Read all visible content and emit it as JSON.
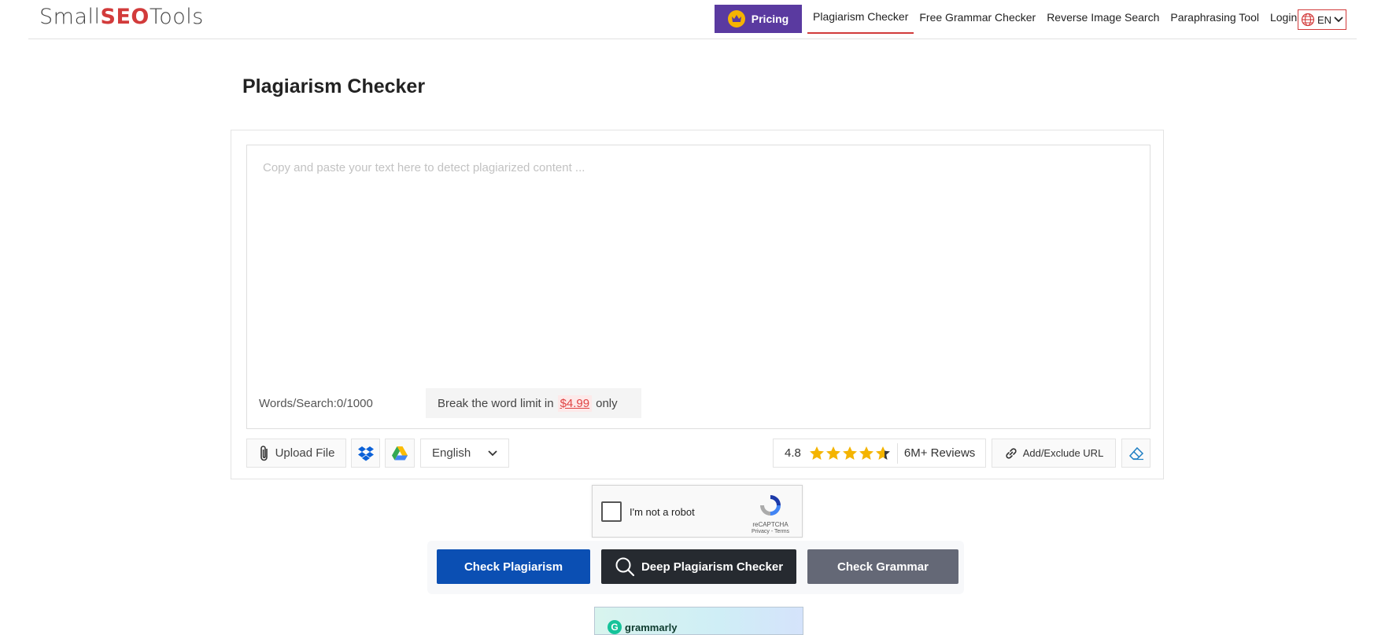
{
  "header": {
    "logo_part1": "Small",
    "logo_part2": "SEO",
    "logo_part3": "Tools",
    "pricing_label": "Pricing",
    "nav": [
      {
        "label": "Plagiarism Checker",
        "active": true
      },
      {
        "label": "Free Grammar Checker",
        "active": false
      },
      {
        "label": "Reverse Image Search",
        "active": false
      },
      {
        "label": "Paraphrasing Tool",
        "active": false
      },
      {
        "label": "Login",
        "active": false
      }
    ],
    "language": "EN"
  },
  "page_title": "Plagiarism Checker",
  "editor": {
    "placeholder": "Copy and paste your text here to detect plagiarized content ...",
    "word_count": "Words/Search:0/1000",
    "limit_prefix": "Break the word limit in",
    "limit_price": "$4.99",
    "limit_suffix": "only"
  },
  "toolbar": {
    "upload_label": "Upload File",
    "language_selected": "English",
    "rating_value": "4.8",
    "reviews_label": "6M+ Reviews",
    "add_url_label": "Add/Exclude URL"
  },
  "captcha": {
    "label": "I'm not a robot",
    "brand": "reCAPTCHA",
    "terms": "Privacy - Terms"
  },
  "actions": {
    "check_plagiarism": "Check Plagiarism",
    "deep_checker": "Deep Plagiarism Checker",
    "check_grammar": "Check Grammar"
  },
  "ad": {
    "brand": "grammarly"
  },
  "colors": {
    "primary_blue": "#0b4fb3",
    "pricing_purple": "#5a3aa0",
    "accent_red": "#d23b3b"
  }
}
